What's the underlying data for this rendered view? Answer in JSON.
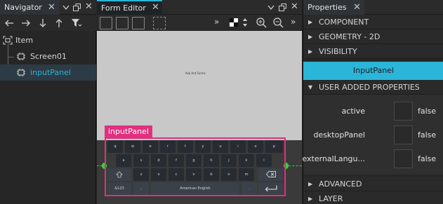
{
  "navigator": {
    "tab_label": "Navigator",
    "root": "Item",
    "children": [
      "Screen01",
      "inputPanel"
    ]
  },
  "form_editor": {
    "tab_label": "Form Editor",
    "canvas_text": "Ask Ant Forms",
    "component_label": "inputPanel",
    "keyboard": {
      "row1": [
        "q",
        "w",
        "e",
        "r",
        "t",
        "y",
        "u",
        "i",
        "o",
        "p"
      ],
      "row2": [
        "a",
        "s",
        "d",
        "f",
        "g",
        "h",
        "j",
        "k",
        "l"
      ],
      "row3": [
        "z",
        "x",
        "c",
        "v",
        "b",
        "n",
        "m"
      ],
      "symbol_key": "&123",
      "comma_key": ",",
      "space_key": "American English",
      "period_key": "."
    }
  },
  "properties": {
    "tab_label": "Properties",
    "sections_top": [
      "COMPONENT",
      "GEOMETRY - 2D",
      "VISIBILITY"
    ],
    "type_name": "InputPanel",
    "user_section": "USER ADDED PROPERTIES",
    "rows": [
      {
        "name": "active",
        "value": "false"
      },
      {
        "name": "desktopPanel",
        "value": "false"
      },
      {
        "name": "externalLangu...",
        "value": "false"
      }
    ],
    "sections_bottom": [
      "ADVANCED",
      "LAYER"
    ]
  },
  "colors": {
    "accent": "#2bb5d8",
    "selection_frame": "#e0307e",
    "handle": "#33d633"
  }
}
